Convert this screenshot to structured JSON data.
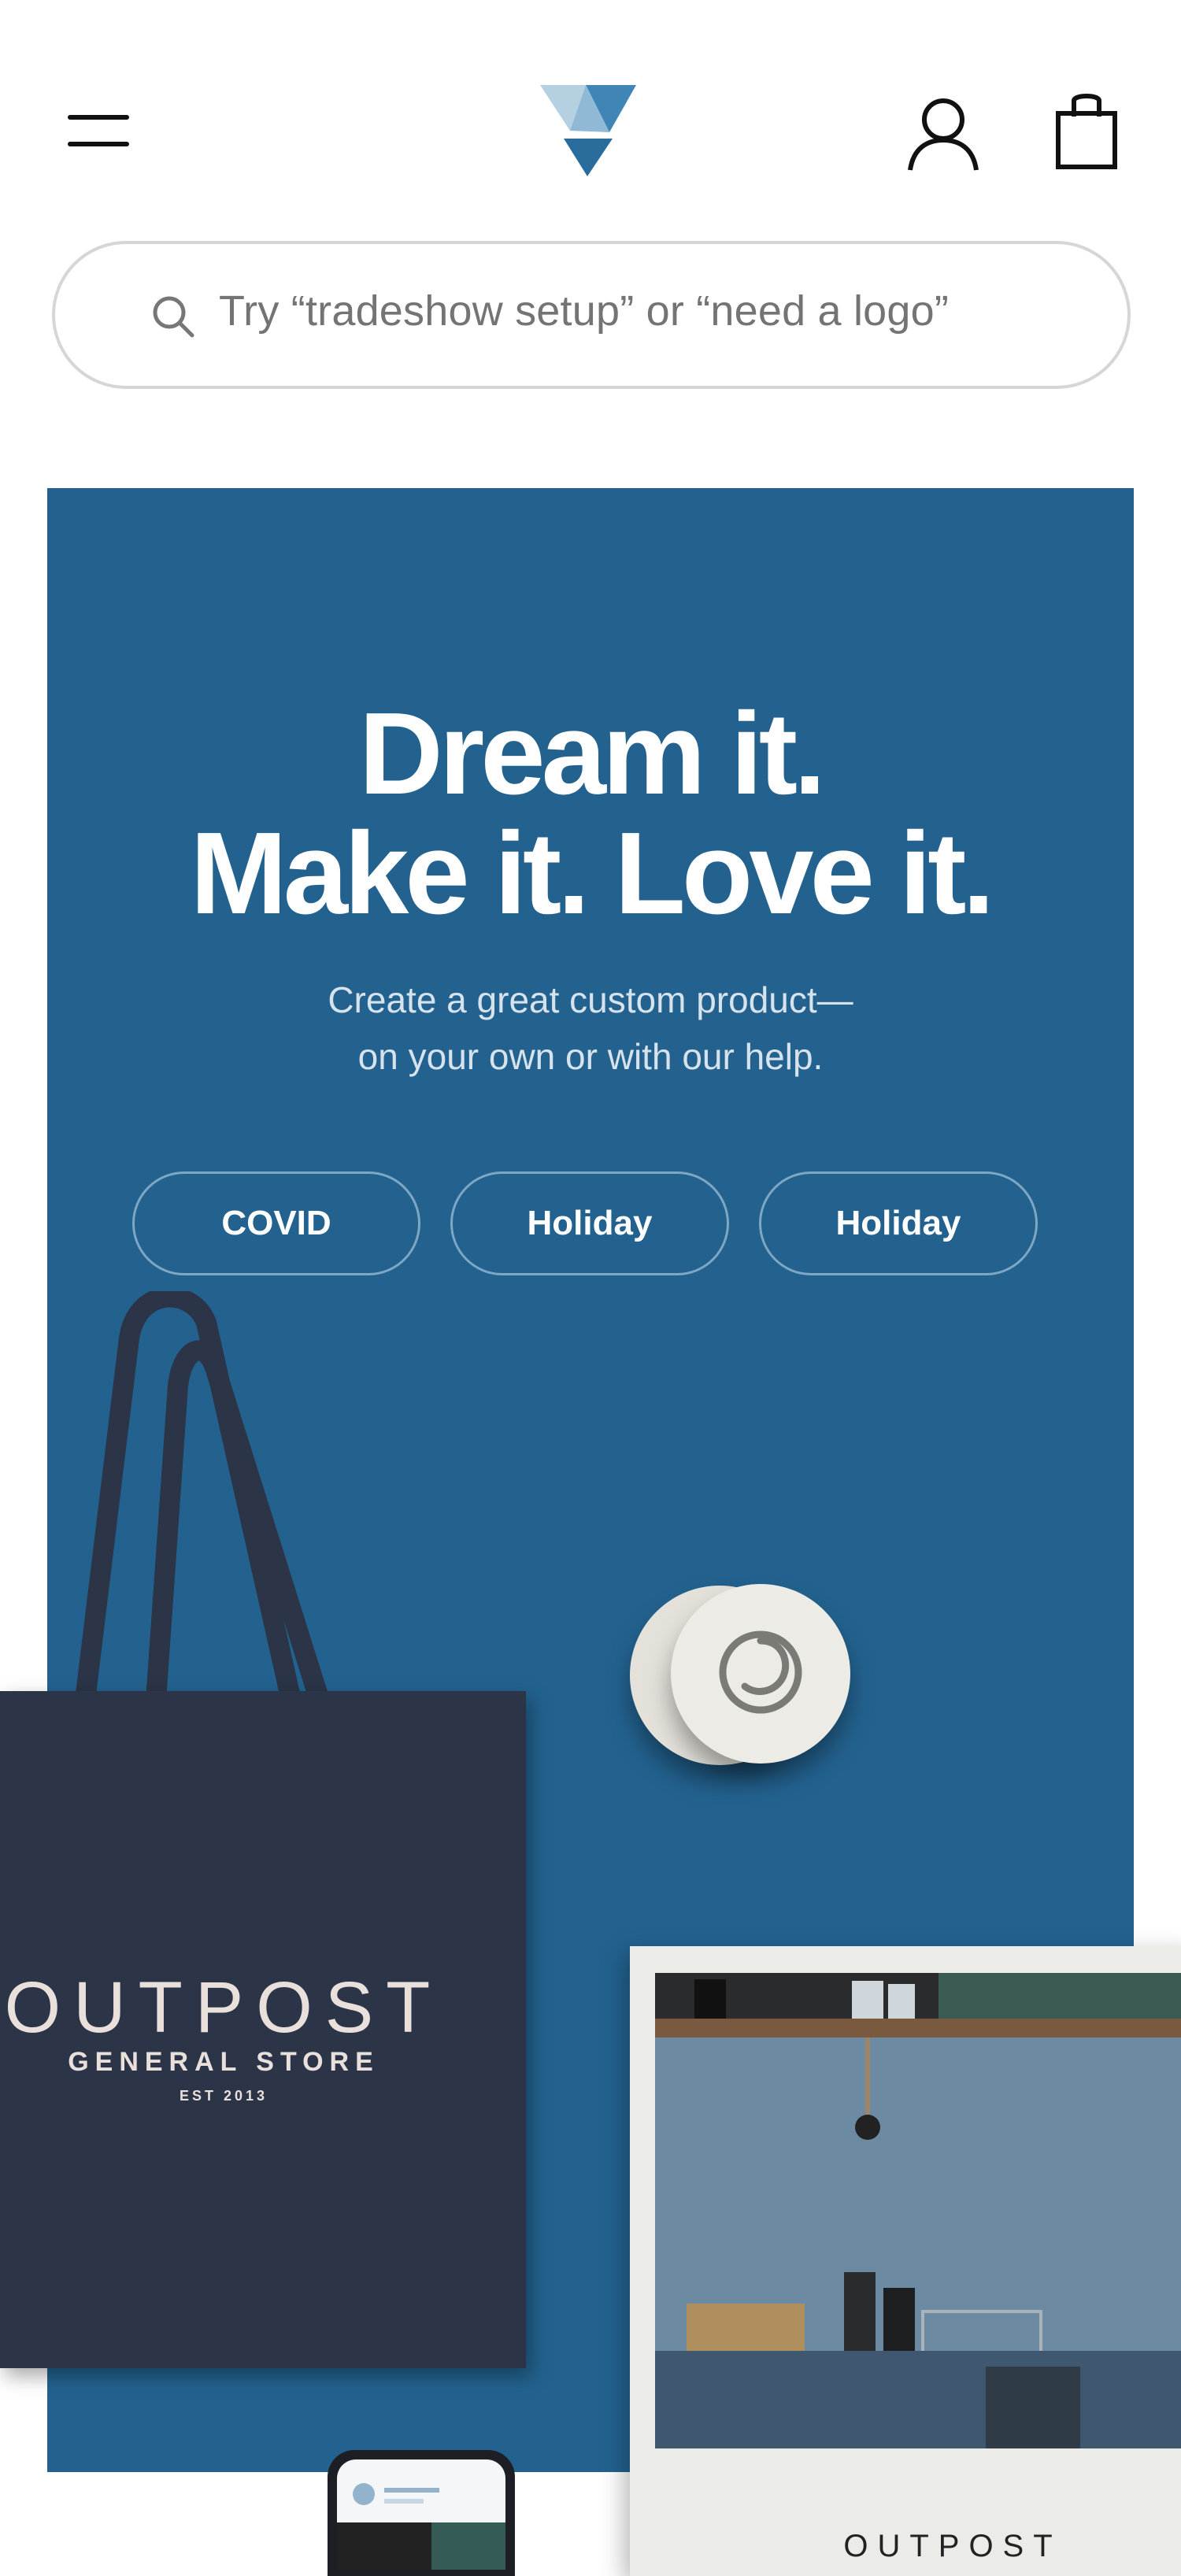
{
  "header": {
    "menu_icon": "hamburger-menu-icon",
    "logo_icon": "vistaprint-v-logo",
    "account_icon": "user-account-icon",
    "cart_icon": "shopping-bag-icon"
  },
  "search": {
    "placeholder": "Try “tradeshow setup” or  “need a logo”",
    "icon": "search-icon"
  },
  "hero": {
    "background": "#23628f",
    "headline_line1": "Dream it.",
    "headline_line2": "Make it. Love it.",
    "subline_line1": "Create a great custom product—",
    "subline_line2": "on your own or with our help.",
    "chips": [
      "COVID",
      "Holiday",
      "Holiday"
    ]
  },
  "tote": {
    "brand": "OUTPOST",
    "subtitle": "GENERAL STORE",
    "established": "EST 2013"
  },
  "card": {
    "brand": "OUTPOST"
  }
}
